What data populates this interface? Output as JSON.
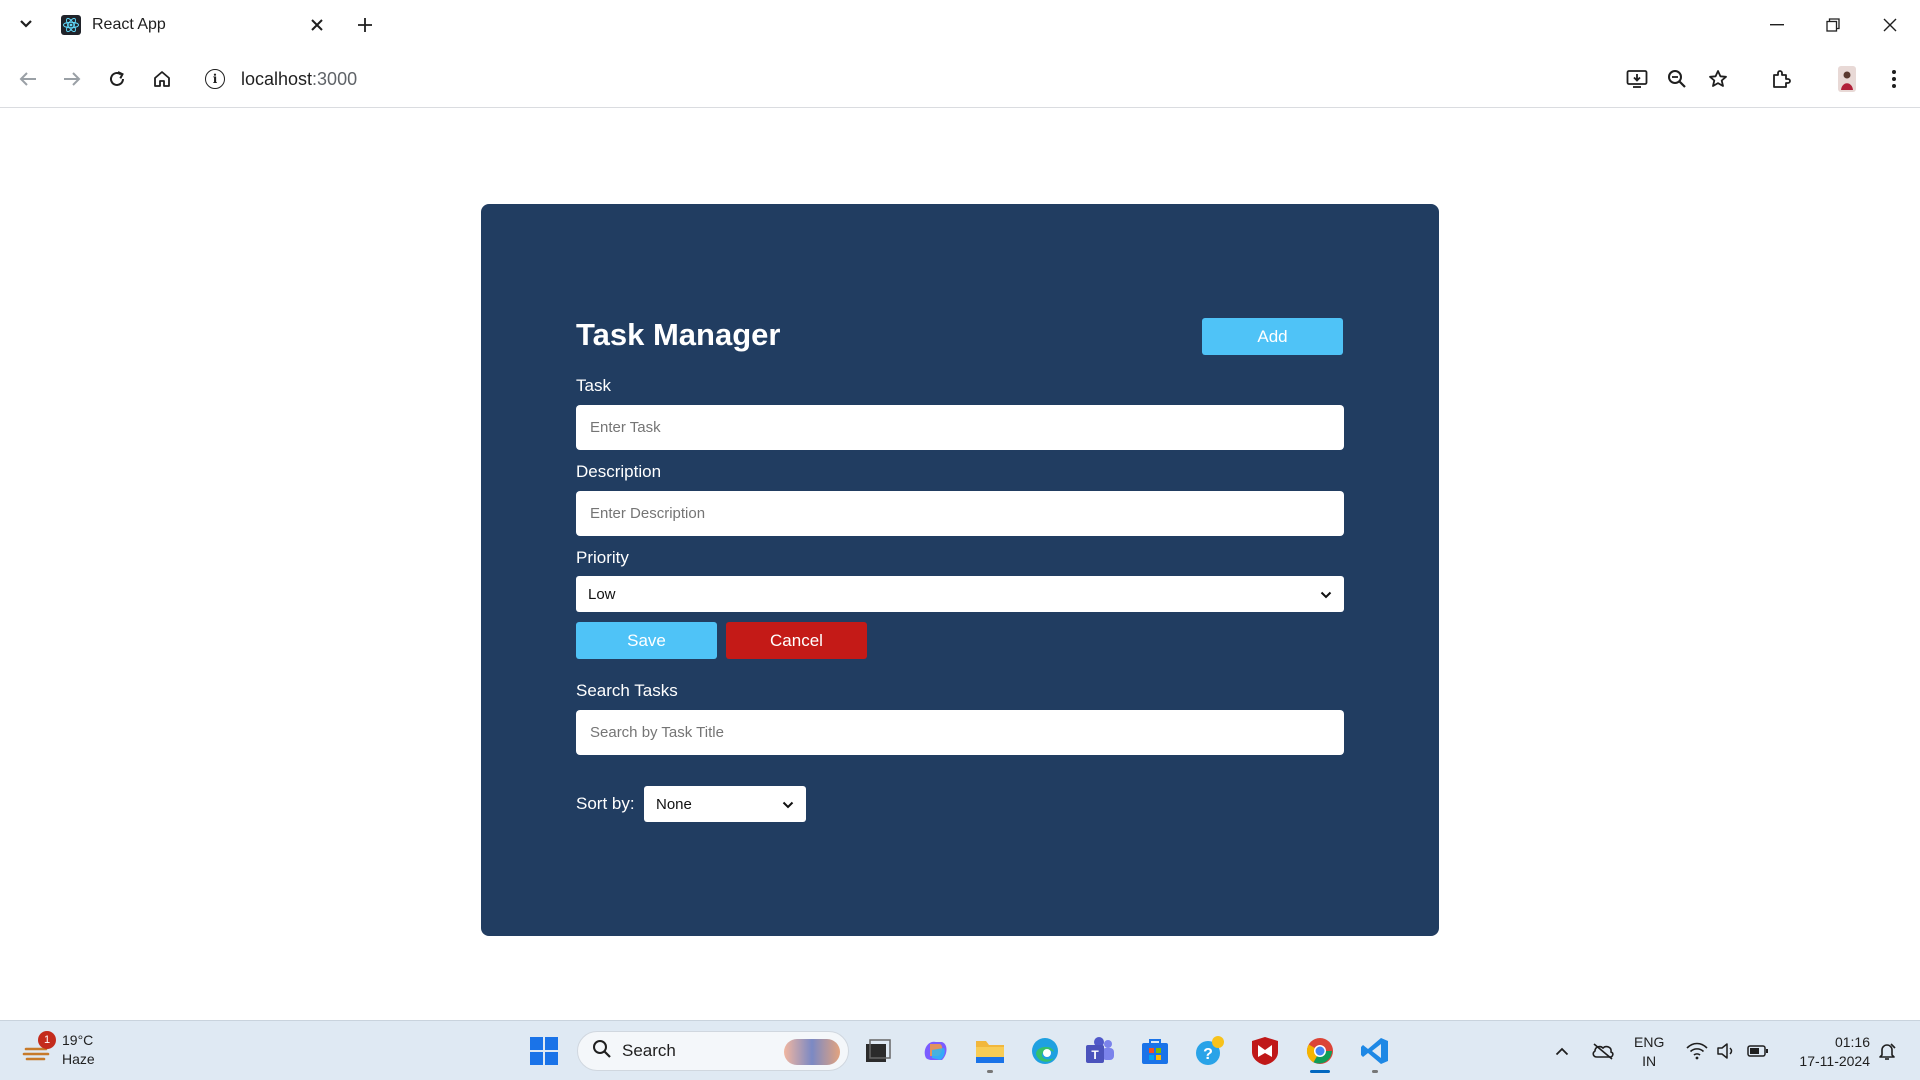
{
  "browser": {
    "tab_title": "React App",
    "url_host": "localhost",
    "url_port": ":3000"
  },
  "app": {
    "title": "Task Manager",
    "add_label": "Add",
    "task_label": "Task",
    "task_placeholder": "Enter Task",
    "description_label": "Description",
    "description_placeholder": "Enter Description",
    "priority_label": "Priority",
    "priority_value": "Low",
    "save_label": "Save",
    "cancel_label": "Cancel",
    "search_label": "Search Tasks",
    "search_placeholder": "Search by Task Title",
    "sort_label": "Sort by:",
    "sort_value": "None"
  },
  "colors": {
    "card_bg": "#213d61",
    "primary_button": "#4fc3f7",
    "cancel_button": "#c41a17"
  },
  "taskbar": {
    "weather_temp": "19°C",
    "weather_desc": "Haze",
    "weather_badge": "1",
    "search_label": "Search",
    "lang_line1": "ENG",
    "lang_line2": "IN",
    "time": "01:16",
    "date": "17-11-2024"
  }
}
